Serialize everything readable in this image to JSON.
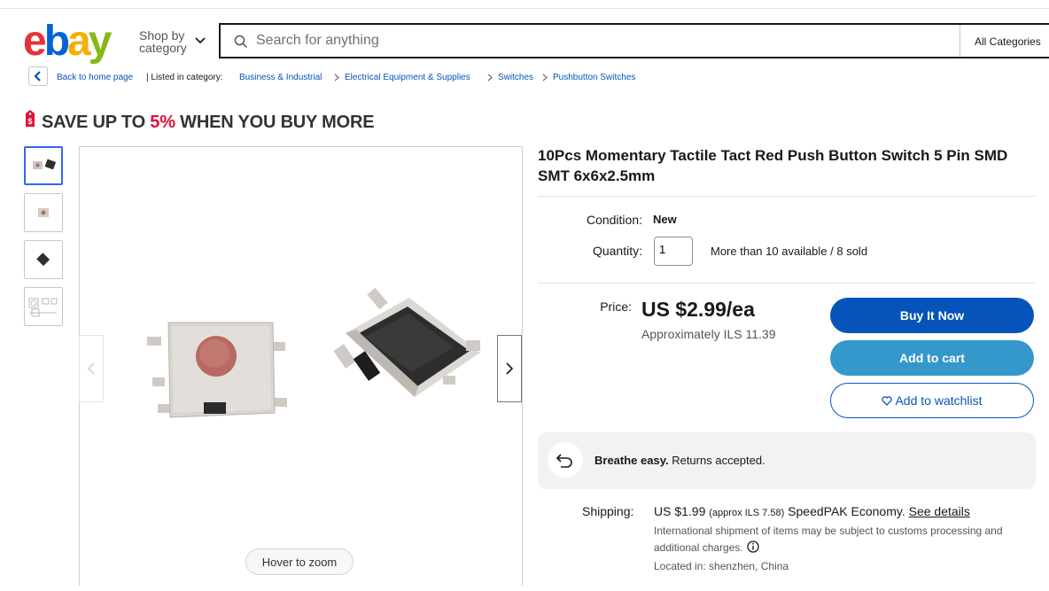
{
  "header": {
    "logo_text": "ebay",
    "shop_by_line1": "Shop by",
    "shop_by_line2": "category",
    "search_placeholder": "Search for anything",
    "category_select": "All Categories"
  },
  "breadcrumb": {
    "back_label": "Back to home page",
    "listed_label": "| Listed in category:",
    "items": [
      "Business & Industrial",
      "Electrical Equipment & Supplies",
      "Switches",
      "Pushbutton Switches"
    ]
  },
  "promo": {
    "prefix": "SAVE UP TO ",
    "percent": "5%",
    "suffix": " WHEN YOU BUY MORE"
  },
  "gallery": {
    "thumbnail_count": 4,
    "selected_index": 0,
    "hover_label": "Hover to zoom"
  },
  "item": {
    "title": "10Pcs Momentary Tactile Tact Red Push Button Switch 5 Pin SMD SMT 6x6x2.5mm",
    "condition_label": "Condition:",
    "condition_value": "New",
    "quantity_label": "Quantity:",
    "quantity_value": "1",
    "availability": "More than 10 available / 8 sold",
    "price_label": "Price:",
    "price": "US $2.99/ea",
    "approx_price": "Approximately ILS 11.39"
  },
  "actions": {
    "buy_now": "Buy It Now",
    "add_to_cart": "Add to cart",
    "watchlist": "Add to watchlist"
  },
  "returns": {
    "bold": "Breathe easy.",
    "text": " Returns accepted."
  },
  "shipping": {
    "label": "Shipping:",
    "price": "US $1.99",
    "approx": "(approx ILS 7.58)",
    "service": "SpeedPAK Economy.",
    "details_link": "See details",
    "note": "International shipment of items may be subject to customs processing and additional charges.",
    "located": "Located in: shenzhen, China"
  },
  "colors": {
    "ebay_red": "#e53238",
    "ebay_blue": "#0064d2",
    "ebay_yellow": "#f5af02",
    "ebay_green": "#86b817",
    "buy_button": "#0654ba",
    "cart_button": "#3498ca",
    "promo_accent": "#e0103a"
  }
}
